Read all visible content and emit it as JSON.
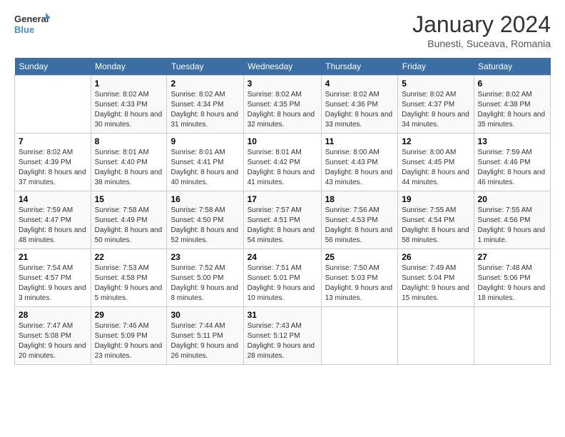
{
  "header": {
    "logo_general": "General",
    "logo_blue": "Blue",
    "month_title": "January 2024",
    "subtitle": "Bunesti, Suceava, Romania"
  },
  "weekdays": [
    "Sunday",
    "Monday",
    "Tuesday",
    "Wednesday",
    "Thursday",
    "Friday",
    "Saturday"
  ],
  "weeks": [
    [
      {
        "day": "",
        "sunrise": "",
        "sunset": "",
        "daylight": ""
      },
      {
        "day": "1",
        "sunrise": "Sunrise: 8:02 AM",
        "sunset": "Sunset: 4:33 PM",
        "daylight": "Daylight: 8 hours and 30 minutes."
      },
      {
        "day": "2",
        "sunrise": "Sunrise: 8:02 AM",
        "sunset": "Sunset: 4:34 PM",
        "daylight": "Daylight: 8 hours and 31 minutes."
      },
      {
        "day": "3",
        "sunrise": "Sunrise: 8:02 AM",
        "sunset": "Sunset: 4:35 PM",
        "daylight": "Daylight: 8 hours and 32 minutes."
      },
      {
        "day": "4",
        "sunrise": "Sunrise: 8:02 AM",
        "sunset": "Sunset: 4:36 PM",
        "daylight": "Daylight: 8 hours and 33 minutes."
      },
      {
        "day": "5",
        "sunrise": "Sunrise: 8:02 AM",
        "sunset": "Sunset: 4:37 PM",
        "daylight": "Daylight: 8 hours and 34 minutes."
      },
      {
        "day": "6",
        "sunrise": "Sunrise: 8:02 AM",
        "sunset": "Sunset: 4:38 PM",
        "daylight": "Daylight: 8 hours and 35 minutes."
      }
    ],
    [
      {
        "day": "7",
        "sunrise": "Sunrise: 8:02 AM",
        "sunset": "Sunset: 4:39 PM",
        "daylight": "Daylight: 8 hours and 37 minutes."
      },
      {
        "day": "8",
        "sunrise": "Sunrise: 8:01 AM",
        "sunset": "Sunset: 4:40 PM",
        "daylight": "Daylight: 8 hours and 38 minutes."
      },
      {
        "day": "9",
        "sunrise": "Sunrise: 8:01 AM",
        "sunset": "Sunset: 4:41 PM",
        "daylight": "Daylight: 8 hours and 40 minutes."
      },
      {
        "day": "10",
        "sunrise": "Sunrise: 8:01 AM",
        "sunset": "Sunset: 4:42 PM",
        "daylight": "Daylight: 8 hours and 41 minutes."
      },
      {
        "day": "11",
        "sunrise": "Sunrise: 8:00 AM",
        "sunset": "Sunset: 4:43 PM",
        "daylight": "Daylight: 8 hours and 43 minutes."
      },
      {
        "day": "12",
        "sunrise": "Sunrise: 8:00 AM",
        "sunset": "Sunset: 4:45 PM",
        "daylight": "Daylight: 8 hours and 44 minutes."
      },
      {
        "day": "13",
        "sunrise": "Sunrise: 7:59 AM",
        "sunset": "Sunset: 4:46 PM",
        "daylight": "Daylight: 8 hours and 46 minutes."
      }
    ],
    [
      {
        "day": "14",
        "sunrise": "Sunrise: 7:59 AM",
        "sunset": "Sunset: 4:47 PM",
        "daylight": "Daylight: 8 hours and 48 minutes."
      },
      {
        "day": "15",
        "sunrise": "Sunrise: 7:58 AM",
        "sunset": "Sunset: 4:49 PM",
        "daylight": "Daylight: 8 hours and 50 minutes."
      },
      {
        "day": "16",
        "sunrise": "Sunrise: 7:58 AM",
        "sunset": "Sunset: 4:50 PM",
        "daylight": "Daylight: 8 hours and 52 minutes."
      },
      {
        "day": "17",
        "sunrise": "Sunrise: 7:57 AM",
        "sunset": "Sunset: 4:51 PM",
        "daylight": "Daylight: 8 hours and 54 minutes."
      },
      {
        "day": "18",
        "sunrise": "Sunrise: 7:56 AM",
        "sunset": "Sunset: 4:53 PM",
        "daylight": "Daylight: 8 hours and 56 minutes."
      },
      {
        "day": "19",
        "sunrise": "Sunrise: 7:55 AM",
        "sunset": "Sunset: 4:54 PM",
        "daylight": "Daylight: 8 hours and 58 minutes."
      },
      {
        "day": "20",
        "sunrise": "Sunrise: 7:55 AM",
        "sunset": "Sunset: 4:56 PM",
        "daylight": "Daylight: 9 hours and 1 minute."
      }
    ],
    [
      {
        "day": "21",
        "sunrise": "Sunrise: 7:54 AM",
        "sunset": "Sunset: 4:57 PM",
        "daylight": "Daylight: 9 hours and 3 minutes."
      },
      {
        "day": "22",
        "sunrise": "Sunrise: 7:53 AM",
        "sunset": "Sunset: 4:58 PM",
        "daylight": "Daylight: 9 hours and 5 minutes."
      },
      {
        "day": "23",
        "sunrise": "Sunrise: 7:52 AM",
        "sunset": "Sunset: 5:00 PM",
        "daylight": "Daylight: 9 hours and 8 minutes."
      },
      {
        "day": "24",
        "sunrise": "Sunrise: 7:51 AM",
        "sunset": "Sunset: 5:01 PM",
        "daylight": "Daylight: 9 hours and 10 minutes."
      },
      {
        "day": "25",
        "sunrise": "Sunrise: 7:50 AM",
        "sunset": "Sunset: 5:03 PM",
        "daylight": "Daylight: 9 hours and 13 minutes."
      },
      {
        "day": "26",
        "sunrise": "Sunrise: 7:49 AM",
        "sunset": "Sunset: 5:04 PM",
        "daylight": "Daylight: 9 hours and 15 minutes."
      },
      {
        "day": "27",
        "sunrise": "Sunrise: 7:48 AM",
        "sunset": "Sunset: 5:06 PM",
        "daylight": "Daylight: 9 hours and 18 minutes."
      }
    ],
    [
      {
        "day": "28",
        "sunrise": "Sunrise: 7:47 AM",
        "sunset": "Sunset: 5:08 PM",
        "daylight": "Daylight: 9 hours and 20 minutes."
      },
      {
        "day": "29",
        "sunrise": "Sunrise: 7:46 AM",
        "sunset": "Sunset: 5:09 PM",
        "daylight": "Daylight: 9 hours and 23 minutes."
      },
      {
        "day": "30",
        "sunrise": "Sunrise: 7:44 AM",
        "sunset": "Sunset: 5:11 PM",
        "daylight": "Daylight: 9 hours and 26 minutes."
      },
      {
        "day": "31",
        "sunrise": "Sunrise: 7:43 AM",
        "sunset": "Sunset: 5:12 PM",
        "daylight": "Daylight: 9 hours and 28 minutes."
      },
      {
        "day": "",
        "sunrise": "",
        "sunset": "",
        "daylight": ""
      },
      {
        "day": "",
        "sunrise": "",
        "sunset": "",
        "daylight": ""
      },
      {
        "day": "",
        "sunrise": "",
        "sunset": "",
        "daylight": ""
      }
    ]
  ]
}
